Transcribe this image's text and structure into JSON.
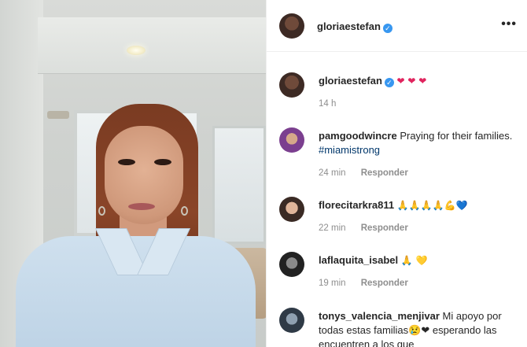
{
  "post": {
    "username": "gloriaestefan",
    "verified": true
  },
  "caption": {
    "username": "gloriaestefan",
    "emojis": "❤ ❤ ❤",
    "time": "14 h"
  },
  "comments": [
    {
      "username": "pamgoodwincre",
      "text": "Praying for their families. ",
      "hashtag": "#miamistrong",
      "time": "24 min",
      "reply": "Responder"
    },
    {
      "username": "florecitarkra811",
      "text": "🙏🙏🙏🙏💪💙",
      "time": "22 min",
      "reply": "Responder"
    },
    {
      "username": "laflaquita_isabel",
      "text": "🙏 💛",
      "time": "19 min",
      "reply": "Responder"
    },
    {
      "username": "tonys_valencia_menjivar",
      "text": "Mi apoyo por todas estas familias😢❤ esperando las encuentren a los que",
      "time": "",
      "reply": ""
    }
  ],
  "icons": {
    "more": "more-options-icon",
    "verified": "verified-badge-icon"
  },
  "colors": {
    "link": "#00376b",
    "verified": "#3897f0",
    "meta": "#8e8e8e"
  }
}
